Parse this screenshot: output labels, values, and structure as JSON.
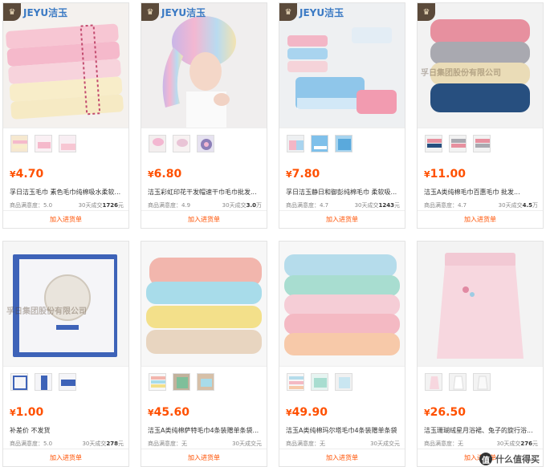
{
  "cart_label": "加入进货单",
  "currency": "¥",
  "brand_text": "JEYU洁玉",
  "watermark": "什么值得买",
  "overlay_text": "孚日集团股份有限公司",
  "products": [
    {
      "price": "4.70",
      "title": "孚日洁玉毛巾 素色毛巾纯棉吸水柔软...",
      "rating_label": "商品满意度：",
      "rating": "5.0",
      "sales_label": "30天成交",
      "sales": "1726",
      "sales_unit": "元",
      "brand": true
    },
    {
      "price": "6.80",
      "title": "洁玉彩虹印花干发帽速干巾毛巾批发...",
      "rating_label": "商品满意度：",
      "rating": "4.9",
      "sales_label": "30天成交",
      "sales": "3.0",
      "sales_unit": "万",
      "brand": true
    },
    {
      "price": "7.80",
      "title": "孚日洁玉静日和御彭纯棉毛巾 柔软吸...",
      "rating_label": "商品满意度：",
      "rating": "4.7",
      "sales_label": "30天成交",
      "sales": "1243",
      "sales_unit": "元",
      "brand": true
    },
    {
      "price": "11.00",
      "title": "洁玉A类纯棉毛巾百惠毛巾 批发...",
      "rating_label": "商品满意度：",
      "rating": "4.7",
      "sales_label": "30天成交",
      "sales": "4.5",
      "sales_unit": "万",
      "brand": true
    },
    {
      "price": "1.00",
      "title": "补差价 不发货",
      "rating_label": "商品满意度：",
      "rating": "5.0",
      "sales_label": "30天成交",
      "sales": "278",
      "sales_unit": "元",
      "brand": false
    },
    {
      "price": "45.60",
      "title": "洁玉A类纯棉萨特毛巾4条装赠单条袋...",
      "rating_label": "商品满意度：",
      "rating": "无",
      "sales_label": "30天成交",
      "sales": "",
      "sales_unit": "元",
      "brand": false
    },
    {
      "price": "49.90",
      "title": "洁玉A类纯棉玛尔塔毛巾4条装赠单条袋",
      "rating_label": "商品满意度：",
      "rating": "无",
      "sales_label": "30天成交",
      "sales": "",
      "sales_unit": "元",
      "brand": false
    },
    {
      "price": "26.50",
      "title": "洁玉珊瑚绒星月浴裙、兔子的旋行浴...",
      "rating_label": "商品满意度：",
      "rating": "无",
      "sales_label": "30天成交",
      "sales": "276",
      "sales_unit": "元",
      "brand": false
    }
  ]
}
